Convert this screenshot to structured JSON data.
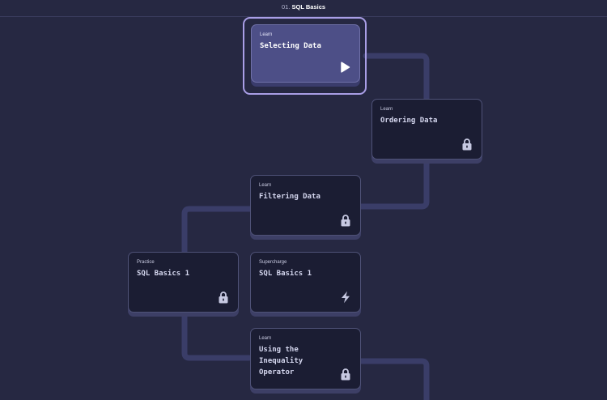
{
  "header": {
    "prefix": "01.",
    "course_title": "SQL Basics"
  },
  "path": [
    {
      "kind": "Learn",
      "title": "Selecting Data",
      "status": "current",
      "icon": "play-icon"
    },
    {
      "kind": "Learn",
      "title": "Ordering Data",
      "status": "locked",
      "icon": "lock-icon"
    },
    {
      "kind": "Learn",
      "title": "Filtering Data",
      "status": "locked",
      "icon": "lock-icon"
    },
    {
      "kind": "Practice",
      "title": "SQL Basics 1",
      "status": "locked",
      "icon": "lock-icon"
    },
    {
      "kind": "Supercharge",
      "title": "SQL Basics 1",
      "status": "locked",
      "icon": "lightning-bolt-icon"
    },
    {
      "kind": "Learn",
      "title": "Using the Inequality Operator",
      "status": "locked",
      "icon": "lock-icon"
    }
  ],
  "colors": {
    "background": "#262842",
    "card": "#1b1d33",
    "active_card": "#4d4f87",
    "active_outline": "#a99ee6",
    "connector": "#3a3d68"
  }
}
